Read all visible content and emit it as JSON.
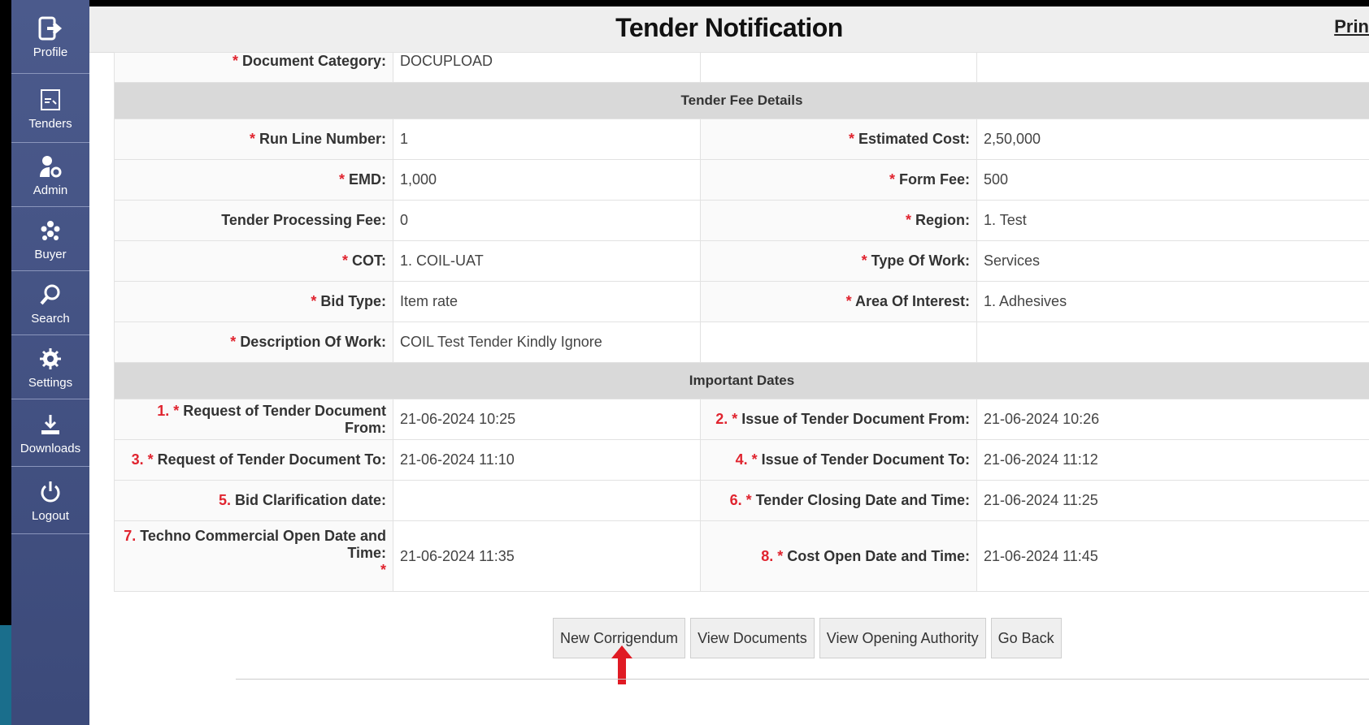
{
  "sidebar": {
    "items": [
      {
        "label": "Profile",
        "icon": "logout-arrow-icon"
      },
      {
        "label": "Tenders",
        "icon": "document-icon"
      },
      {
        "label": "Admin",
        "icon": "user-gear-icon"
      },
      {
        "label": "Buyer",
        "icon": "group-icon"
      },
      {
        "label": "Search",
        "icon": "search-icon"
      },
      {
        "label": "Settings",
        "icon": "gear-icon"
      },
      {
        "label": "Downloads",
        "icon": "download-icon"
      },
      {
        "label": "Logout",
        "icon": "power-icon"
      }
    ]
  },
  "header": {
    "title": "Tender Notification",
    "print": "Prin"
  },
  "doc_category": {
    "label": "Document Category:",
    "value": "DOCUPLOAD"
  },
  "fee_section": "Tender Fee Details",
  "fee_rows": [
    {
      "l1": "Run Line Number:",
      "s1": true,
      "v1": "1",
      "l2": "Estimated Cost:",
      "s2": true,
      "v2": "2,50,000"
    },
    {
      "l1": "EMD:",
      "s1": true,
      "v1": "1,000",
      "l2": "Form Fee:",
      "s2": true,
      "v2": "500"
    },
    {
      "l1": "Tender Processing Fee:",
      "s1": false,
      "v1": "0",
      "l2": "Region:",
      "s2": true,
      "v2": "1. Test"
    },
    {
      "l1": "COT:",
      "s1": true,
      "v1": "1. COIL-UAT",
      "l2": "Type Of Work:",
      "s2": true,
      "v2": "Services"
    },
    {
      "l1": "Bid Type:",
      "s1": true,
      "v1": "Item rate",
      "l2": "Area Of Interest:",
      "s2": true,
      "v2": "1. Adhesives"
    }
  ],
  "description": {
    "label": "Description Of Work:",
    "value": "COIL Test Tender Kindly Ignore"
  },
  "dates_section": "Important Dates",
  "date_rows": [
    {
      "n1": "1.",
      "l1": "Request of Tender Document From:",
      "s1": true,
      "v1": "21-06-2024 10:25",
      "n2": "2.",
      "l2": "Issue of Tender Document From:",
      "s2": true,
      "v2": "21-06-2024 10:26"
    },
    {
      "n1": "3.",
      "l1": "Request of Tender Document To:",
      "s1": true,
      "v1": "21-06-2024 11:10",
      "n2": "4.",
      "l2": "Issue of Tender Document To:",
      "s2": true,
      "v2": "21-06-2024 11:12"
    },
    {
      "n1": "5.",
      "l1": "Bid Clarification date:",
      "s1": false,
      "v1": "",
      "n2": "6.",
      "l2": "Tender Closing Date and Time:",
      "s2": true,
      "v2": "21-06-2024 11:25"
    }
  ],
  "last_row": {
    "n1": "7.",
    "l1": "Techno Commercial Open Date and Time:",
    "v1": "21-06-2024 11:35",
    "n2": "8.",
    "l2": "Cost Open Date and Time:",
    "v2": "21-06-2024 11:45"
  },
  "buttons": [
    "New Corrigendum",
    "View Documents",
    "View Opening Authority",
    "Go Back"
  ]
}
